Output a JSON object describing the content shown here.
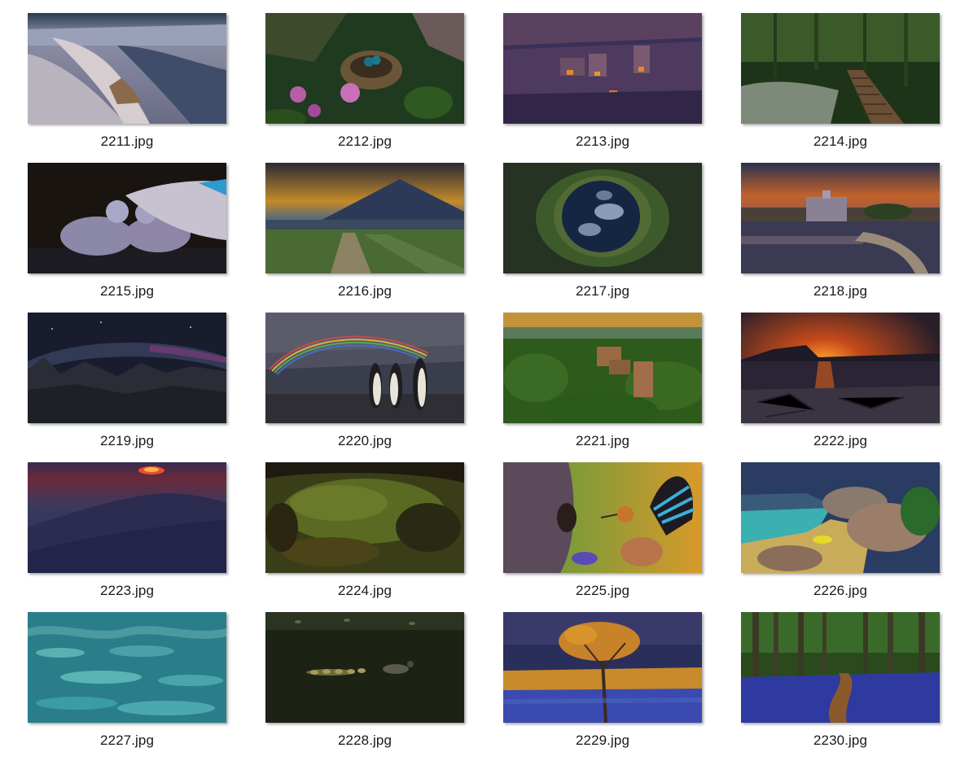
{
  "files": [
    {
      "name": "2211.jpg",
      "scene": "snowy-canyon-aerial"
    },
    {
      "name": "2212.jpg",
      "scene": "bird-nest-blossoms"
    },
    {
      "name": "2213.jpg",
      "scene": "cliff-dwelling-night"
    },
    {
      "name": "2214.jpg",
      "scene": "forest-boardwalk-stream"
    },
    {
      "name": "2215.jpg",
      "scene": "cygnets-swan-wing"
    },
    {
      "name": "2216.jpg",
      "scene": "volcano-farm-road"
    },
    {
      "name": "2217.jpg",
      "scene": "forest-canopy-sky-hole"
    },
    {
      "name": "2218.jpg",
      "scene": "palace-lake-sunset"
    },
    {
      "name": "2219.jpg",
      "scene": "milky-way-mountains"
    },
    {
      "name": "2220.jpg",
      "scene": "penguins-rainbow"
    },
    {
      "name": "2221.jpg",
      "scene": "castle-ruin-forest"
    },
    {
      "name": "2222.jpg",
      "scene": "rocky-shore-sunset"
    },
    {
      "name": "2223.jpg",
      "scene": "red-sun-mountain-dusk"
    },
    {
      "name": "2224.jpg",
      "scene": "mossy-ground"
    },
    {
      "name": "2225.jpg",
      "scene": "hoopoe-tree-hole"
    },
    {
      "name": "2226.jpg",
      "scene": "granite-beach-lagoon"
    },
    {
      "name": "2227.jpg",
      "scene": "turquoise-ice-pools"
    },
    {
      "name": "2228.jpg",
      "scene": "duck-ducklings-lake"
    },
    {
      "name": "2229.jpg",
      "scene": "acacia-tree-bluebells"
    },
    {
      "name": "2230.jpg",
      "scene": "bluebell-forest-path"
    }
  ]
}
